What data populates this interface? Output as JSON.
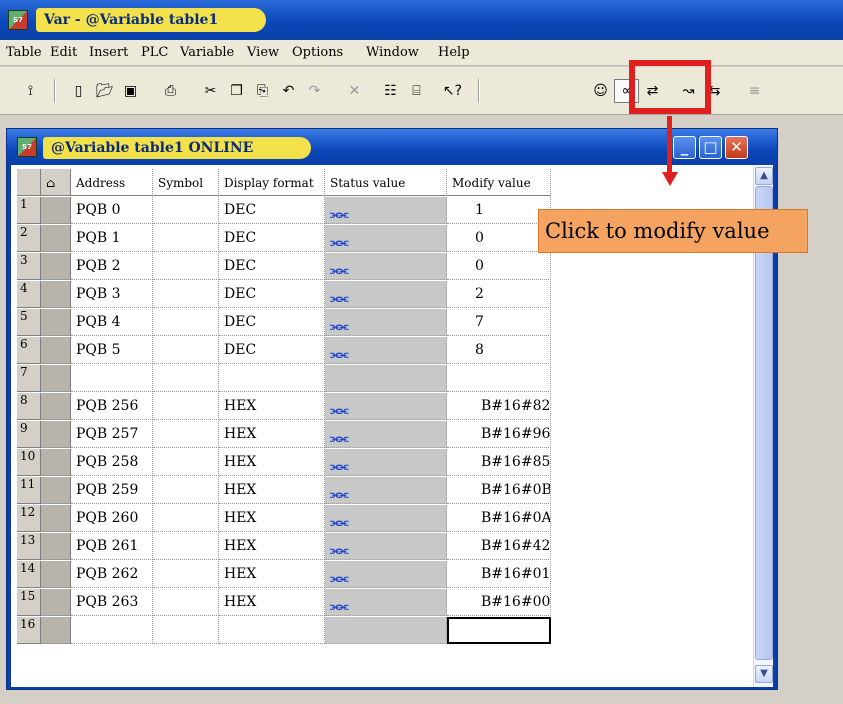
{
  "app": {
    "title": "Var - @Variable table1",
    "logo_text": "S7"
  },
  "menu": [
    "Table",
    "Edit",
    "Insert",
    "PLC",
    "Variable",
    "View",
    "Options",
    "Window",
    "Help"
  ],
  "toolbar_icons": [
    "pin-icon",
    "new-icon",
    "open-icon",
    "save-icon",
    "print-icon",
    "cut-icon",
    "copy-icon",
    "paste-icon",
    "undo-icon",
    "redo-icon",
    "delete-icon",
    "network-icon",
    "monitor-plc-icon",
    "help-icon",
    "online-icon",
    "monitor-variable-icon",
    "modify-variable-icon",
    "trigger-icon",
    "update-values-icon",
    "force-icon"
  ],
  "child": {
    "title": "@Variable table1  ONLINE"
  },
  "table": {
    "headers": {
      "address": "Address",
      "symbol": "Symbol",
      "format": "Display format",
      "status": "Status value",
      "modify": "Modify value"
    },
    "rows": [
      {
        "num": "1",
        "address": "PQB   0",
        "symbol": "",
        "format": "DEC",
        "status_icon": true,
        "modify": "1"
      },
      {
        "num": "2",
        "address": "PQB   1",
        "symbol": "",
        "format": "DEC",
        "status_icon": true,
        "modify": "0"
      },
      {
        "num": "3",
        "address": "PQB   2",
        "symbol": "",
        "format": "DEC",
        "status_icon": true,
        "modify": "0"
      },
      {
        "num": "4",
        "address": "PQB   3",
        "symbol": "",
        "format": "DEC",
        "status_icon": true,
        "modify": "2"
      },
      {
        "num": "5",
        "address": "PQB   4",
        "symbol": "",
        "format": "DEC",
        "status_icon": true,
        "modify": "7"
      },
      {
        "num": "6",
        "address": "PQB   5",
        "symbol": "",
        "format": "DEC",
        "status_icon": true,
        "modify": "8"
      },
      {
        "num": "7",
        "address": "",
        "symbol": "",
        "format": "",
        "status_icon": false,
        "modify": ""
      },
      {
        "num": "8",
        "address": "PQB 256",
        "symbol": "",
        "format": "HEX",
        "status_icon": true,
        "modify": "B#16#82"
      },
      {
        "num": "9",
        "address": "PQB 257",
        "symbol": "",
        "format": "HEX",
        "status_icon": true,
        "modify": "B#16#96"
      },
      {
        "num": "10",
        "address": "PQB 258",
        "symbol": "",
        "format": "HEX",
        "status_icon": true,
        "modify": "B#16#85"
      },
      {
        "num": "11",
        "address": "PQB 259",
        "symbol": "",
        "format": "HEX",
        "status_icon": true,
        "modify": "B#16#0B"
      },
      {
        "num": "12",
        "address": "PQB 260",
        "symbol": "",
        "format": "HEX",
        "status_icon": true,
        "modify": "B#16#0A"
      },
      {
        "num": "13",
        "address": "PQB 261",
        "symbol": "",
        "format": "HEX",
        "status_icon": true,
        "modify": "B#16#42"
      },
      {
        "num": "14",
        "address": "PQB 262",
        "symbol": "",
        "format": "HEX",
        "status_icon": true,
        "modify": "B#16#01"
      },
      {
        "num": "15",
        "address": "PQB 263",
        "symbol": "",
        "format": "HEX",
        "status_icon": true,
        "modify": "B#16#00"
      },
      {
        "num": "16",
        "address": "",
        "symbol": "",
        "format": "",
        "status_icon": false,
        "modify": ""
      }
    ]
  },
  "annotation": {
    "callout_text": "Click to modify value"
  },
  "colors": {
    "title_pill": "#f2e14a",
    "highlight": "#e01f1f",
    "callout_bg": "#f4a460",
    "status_col": "#c8c8c8"
  }
}
